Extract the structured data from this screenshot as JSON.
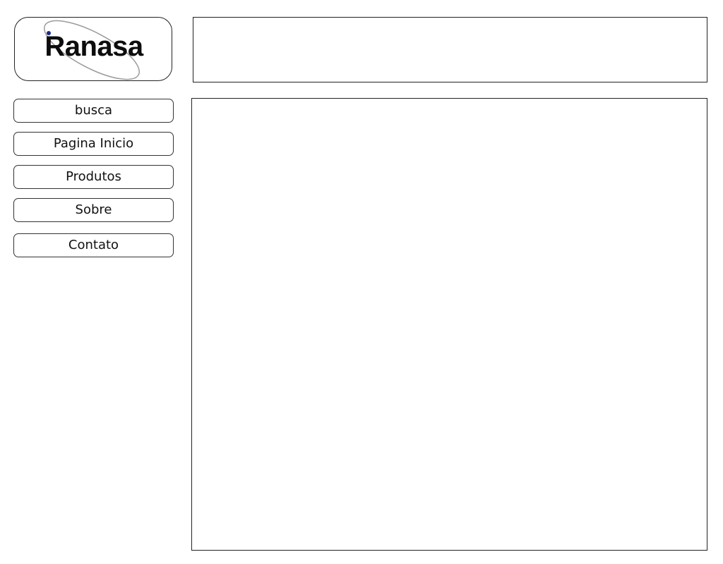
{
  "logo": {
    "text": "Ranasa",
    "accent_color": "#1b2a8a",
    "ring_color": "#9a9a9a"
  },
  "nav": {
    "items": [
      {
        "label": "busca"
      },
      {
        "label": "Pagina Inicio"
      },
      {
        "label": "Produtos"
      },
      {
        "label": "Sobre"
      },
      {
        "label": "Contato"
      }
    ]
  }
}
